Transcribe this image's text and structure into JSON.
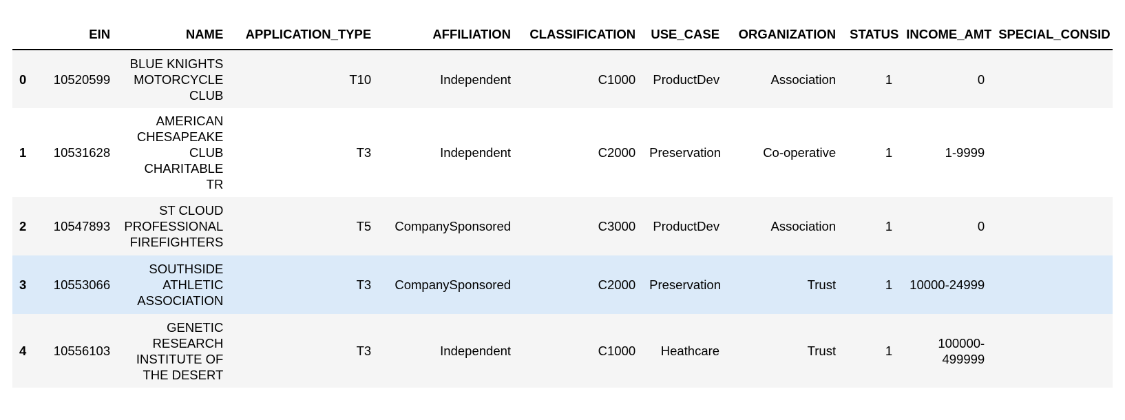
{
  "columns": {
    "index": "",
    "ein": "EIN",
    "name": "NAME",
    "application_type": "APPLICATION_TYPE",
    "affiliation": "AFFILIATION",
    "classification": "CLASSIFICATION",
    "use_case": "USE_CASE",
    "organization": "ORGANIZATION",
    "status": "STATUS",
    "income_amt": "INCOME_AMT",
    "special": "SPECIAL_CONSID"
  },
  "rows": [
    {
      "index": "0",
      "ein": "10520599",
      "name": "BLUE KNIGHTS MOTORCYCLE CLUB",
      "application_type": "T10",
      "affiliation": "Independent",
      "classification": "C1000",
      "use_case": "ProductDev",
      "organization": "Association",
      "status": "1",
      "income_amt": "0",
      "special": ""
    },
    {
      "index": "1",
      "ein": "10531628",
      "name": "AMERICAN CHESAPEAKE CLUB CHARITABLE TR",
      "application_type": "T3",
      "affiliation": "Independent",
      "classification": "C2000",
      "use_case": "Preservation",
      "organization": "Co-operative",
      "status": "1",
      "income_amt": "1-9999",
      "special": ""
    },
    {
      "index": "2",
      "ein": "10547893",
      "name": "ST CLOUD PROFESSIONAL FIREFIGHTERS",
      "application_type": "T5",
      "affiliation": "CompanySponsored",
      "classification": "C3000",
      "use_case": "ProductDev",
      "organization": "Association",
      "status": "1",
      "income_amt": "0",
      "special": ""
    },
    {
      "index": "3",
      "ein": "10553066",
      "name": "SOUTHSIDE ATHLETIC ASSOCIATION",
      "application_type": "T3",
      "affiliation": "CompanySponsored",
      "classification": "C2000",
      "use_case": "Preservation",
      "organization": "Trust",
      "status": "1",
      "income_amt": "10000-24999",
      "special": ""
    },
    {
      "index": "4",
      "ein": "10556103",
      "name": "GENETIC RESEARCH INSTITUTE OF THE DESERT",
      "application_type": "T3",
      "affiliation": "Independent",
      "classification": "C1000",
      "use_case": "Heathcare",
      "organization": "Trust",
      "status": "1",
      "income_amt": "100000-499999",
      "special": ""
    }
  ],
  "colors": {
    "stripe": "#f5f5f5",
    "hover": "#dbeaf9",
    "header_rule": "#000000"
  }
}
